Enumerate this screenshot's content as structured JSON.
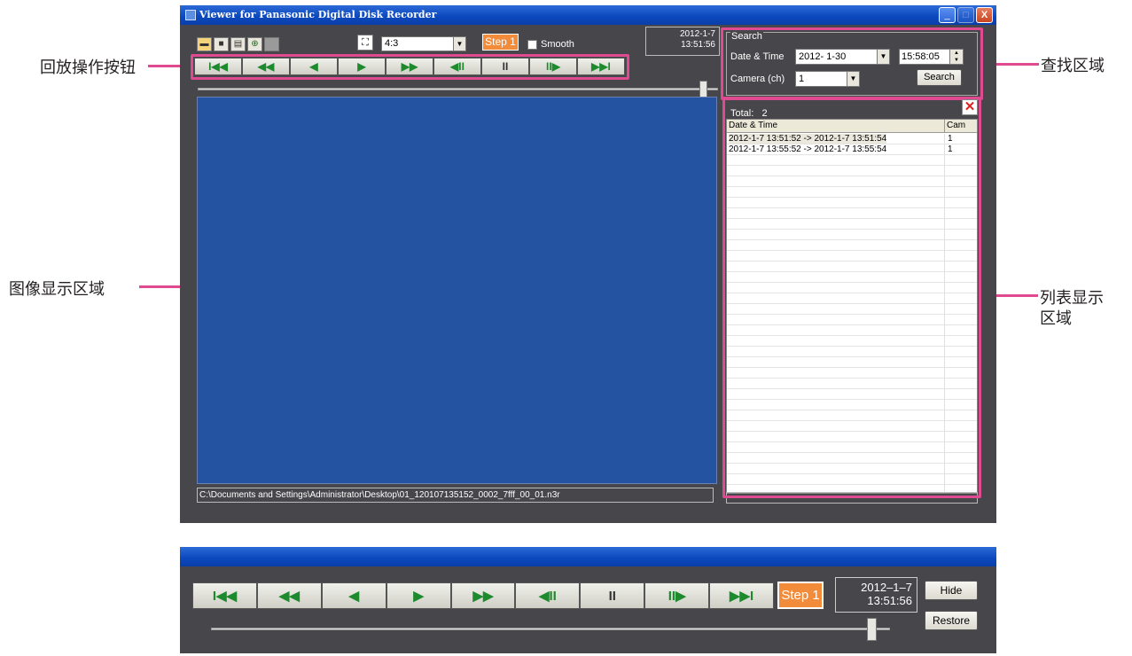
{
  "window": {
    "title": "Viewer for Panasonic Digital Disk Recorder",
    "min_glyph": "_",
    "max_glyph": "□",
    "close_glyph": "X"
  },
  "toolbar": {
    "icons": [
      "open-folder-icon",
      "save-icon",
      "print-icon",
      "zoom-in-icon",
      "zoom-disabled-icon"
    ],
    "aspect_ratio": "4:3",
    "step_label": "Step 1",
    "smooth_label": "Smooth",
    "smooth_checked": false,
    "current_date": "2012-1-7",
    "current_time": "13:51:56"
  },
  "playback": {
    "buttons": [
      {
        "name": "skip-to-start",
        "glyph": "I◀◀"
      },
      {
        "name": "fast-rewind",
        "glyph": "◀◀"
      },
      {
        "name": "reverse-play",
        "glyph": "◀"
      },
      {
        "name": "play",
        "glyph": "▶"
      },
      {
        "name": "fast-forward",
        "glyph": "▶▶"
      },
      {
        "name": "step-back",
        "glyph": "◀II"
      },
      {
        "name": "pause",
        "glyph": "II"
      },
      {
        "name": "step-forward",
        "glyph": "II▶"
      },
      {
        "name": "skip-to-end",
        "glyph": "▶▶I"
      }
    ],
    "position_fraction": 0.98
  },
  "status": {
    "file_path": "C:\\Documents and Settings\\Administrator\\Desktop\\01_120107135152_0002_7fff_00_01.n3r"
  },
  "search": {
    "group_label": "Search",
    "date_time_label": "Date & Time",
    "date_value": "2012- 1-30",
    "time_value": "15:58:05",
    "camera_label": "Camera (ch)",
    "camera_value": "1",
    "button_label": "Search"
  },
  "list": {
    "total_label": "Total:",
    "total_count": "2",
    "headers": [
      "Date & Time",
      "Cam"
    ],
    "rows": [
      {
        "datetime": "2012-1-7 13:51:52 -> 2012-1-7 13:51:54",
        "cam": "1"
      },
      {
        "datetime": "2012-1-7 13:55:52 -> 2012-1-7 13:55:54",
        "cam": "1"
      }
    ]
  },
  "callouts": {
    "playback": "回放操作按钮",
    "search": "查找区域",
    "image": "图像显示区域",
    "list_line1": "列表显示",
    "list_line2": "区域"
  },
  "mini_window": {
    "step_label": "Step 1",
    "current_date": "2012–1–7",
    "current_time": "13:51:56",
    "hide_label": "Hide",
    "restore_label": "Restore"
  },
  "colors": {
    "accent_highlight": "#e04a91",
    "title_bar": "#0b47bd",
    "video_area": "#2453a2",
    "step_button": "#f28b3a",
    "play_glyph": "#1e8a2e"
  }
}
